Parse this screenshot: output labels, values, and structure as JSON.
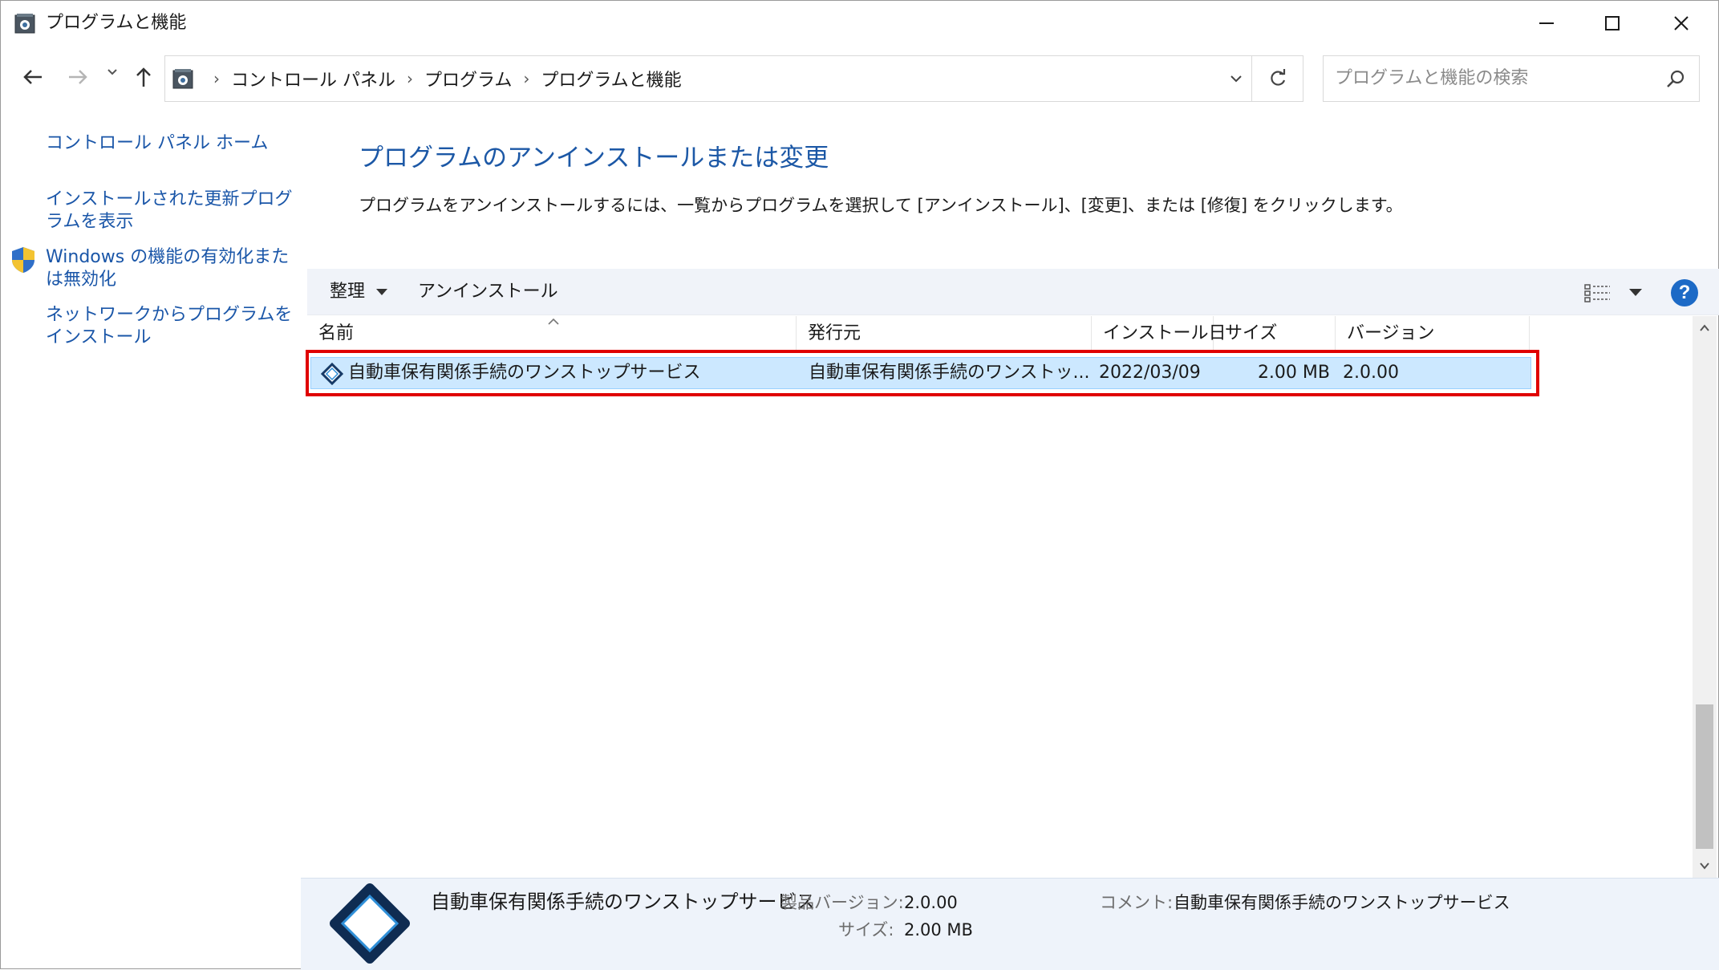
{
  "window": {
    "title": "プログラムと機能",
    "controls": {
      "minimize": "—",
      "maximize": "☐",
      "close": "✕"
    }
  },
  "address": {
    "breadcrumbs": [
      "コントロール パネル",
      "プログラム",
      "プログラムと機能"
    ],
    "search_placeholder": "プログラムと機能の検索"
  },
  "sidebar": {
    "items": [
      {
        "label": "コントロール パネル ホーム"
      },
      {
        "label": "インストールされた更新プログラムを表示"
      },
      {
        "label": "Windows の機能の有効化または無効化",
        "icon": "shield-icon"
      },
      {
        "label": "ネットワークからプログラムをインストール"
      }
    ]
  },
  "main": {
    "heading": "プログラムのアンインストールまたは変更",
    "description": "プログラムをアンインストールするには、一覧からプログラムを選択して [アンインストール]、[変更]、または [修復] をクリックします。"
  },
  "toolbar": {
    "organize": "整理",
    "uninstall": "アンインストール",
    "help": "?"
  },
  "table": {
    "columns": [
      "名前",
      "発行元",
      "インストール日",
      "サイズ",
      "バージョン"
    ],
    "rows": [
      {
        "name": "自動車保有関係手続のワンストップサービス",
        "publisher": "自動車保有関係手続のワンストッ...",
        "install_date": "2022/03/09",
        "size": "2.00 MB",
        "version": "2.0.00",
        "selected": true
      }
    ]
  },
  "details": {
    "name": "自動車保有関係手続のワンストップサービス",
    "version_label": "製品バージョン:",
    "version": "2.0.00",
    "size_label": "サイズ:",
    "size": "2.00 MB",
    "comment_label": "コメント:",
    "comment": "自動車保有関係手続のワンストップサービス"
  },
  "colors": {
    "link": "#1a56a8",
    "heading": "#1c58a6",
    "selection": "#cce8ff",
    "highlight_border": "#e00000",
    "details_bg": "#eef3fa"
  }
}
